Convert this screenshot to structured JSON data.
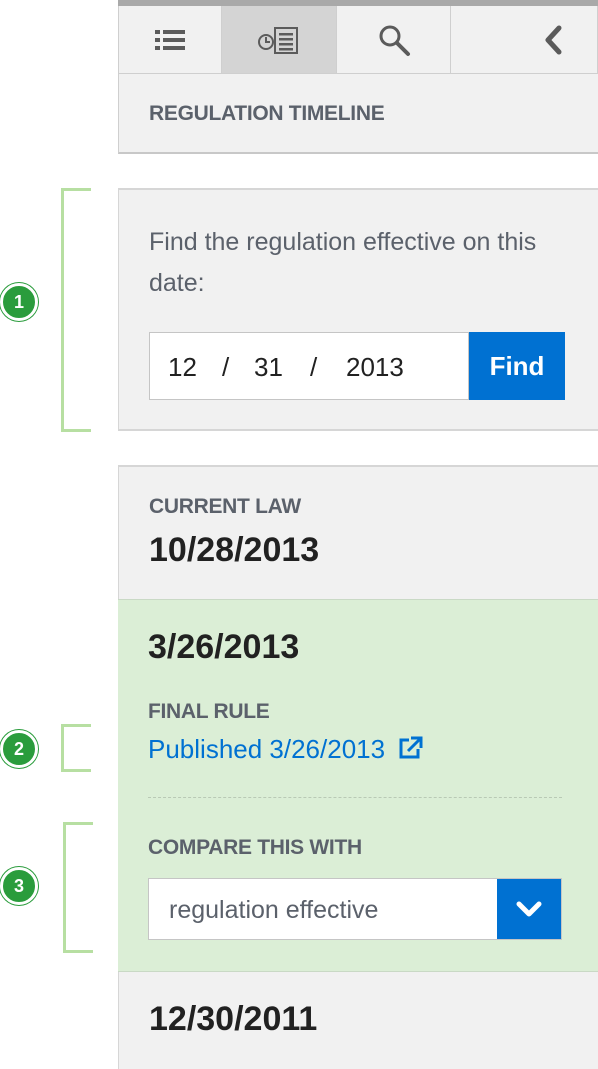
{
  "toolbar": {
    "buttons": [
      {
        "icon": "list-icon"
      },
      {
        "icon": "timeline-icon",
        "active": true
      },
      {
        "icon": "search-icon"
      },
      {
        "icon": "chevron-left-icon"
      }
    ]
  },
  "section_title": "REGULATION TIMELINE",
  "finder": {
    "prompt": "Find the regulation effective on this date:",
    "month": "12",
    "separator": "/",
    "day": "31",
    "year": "2013",
    "button_label": "Find"
  },
  "timeline": {
    "current_label": "CURRENT LAW",
    "current_date": "10/28/2013",
    "selected_date": "3/26/2013",
    "final_rule_label": "FINAL RULE",
    "published_link": "Published 3/26/2013",
    "compare_label": "COMPARE THIS WITH",
    "compare_value": "regulation effective",
    "older_date": "12/30/2011"
  },
  "callouts": [
    "1",
    "2",
    "3"
  ],
  "colors": {
    "accent": "#0071d2",
    "selected_bg": "#dbeed6",
    "callout_green": "#2a9c3c",
    "bracket_green": "#b7dfa2"
  }
}
